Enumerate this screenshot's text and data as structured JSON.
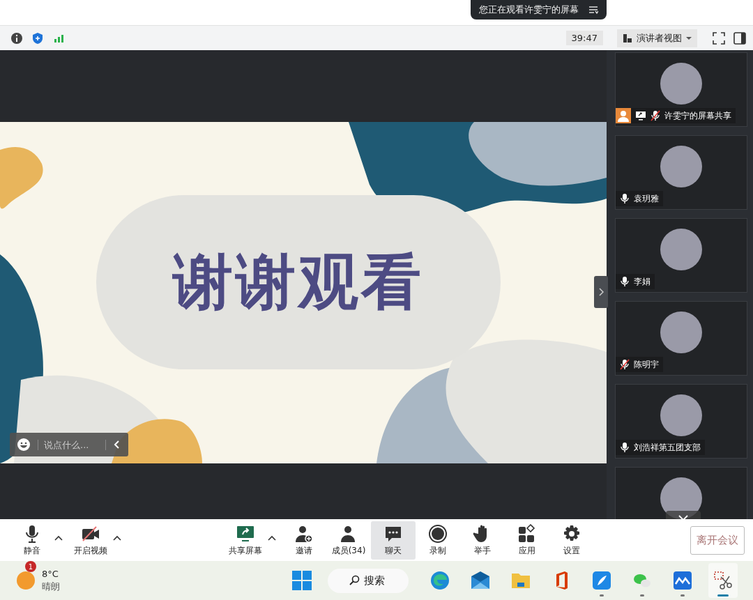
{
  "banner": {
    "text": "您正在观看许雯宁的屏幕"
  },
  "top_bar": {
    "timer": "39:47",
    "view_button": "演讲者视图"
  },
  "slide": {
    "title": "谢谢观看"
  },
  "chat_input": {
    "placeholder": "说点什么..."
  },
  "participants": [
    {
      "kind": "sharer",
      "name": "许雯宁的屏幕共享",
      "muted": true
    },
    {
      "kind": "member",
      "name": "袁玥雅",
      "muted": false
    },
    {
      "kind": "member",
      "name": "李娟",
      "muted": false
    },
    {
      "kind": "member",
      "name": "陈明宇",
      "muted": true
    },
    {
      "kind": "member",
      "name": "刘浩祥第五团支部",
      "muted": false
    },
    {
      "kind": "partial"
    }
  ],
  "toolbar": [
    {
      "kind": "mic",
      "label": "静音",
      "menu": true,
      "selected": false
    },
    {
      "kind": "video",
      "label": "开启视频",
      "menu": true,
      "selected": false
    },
    {
      "kind": "share",
      "label": "共享屏幕",
      "menu": true,
      "selected": false
    },
    {
      "kind": "invite",
      "label": "邀请",
      "menu": false,
      "selected": false
    },
    {
      "kind": "members",
      "label": "成员(34)",
      "menu": false,
      "selected": false
    },
    {
      "kind": "chat",
      "label": "聊天",
      "menu": false,
      "selected": true
    },
    {
      "kind": "record",
      "label": "录制",
      "menu": false,
      "selected": false
    },
    {
      "kind": "hand",
      "label": "举手",
      "menu": false,
      "selected": false
    },
    {
      "kind": "apps",
      "label": "应用",
      "menu": false,
      "selected": false
    },
    {
      "kind": "settings",
      "label": "设置",
      "menu": false,
      "selected": false
    }
  ],
  "leave_button": "离开会议",
  "taskbar": {
    "weather": {
      "badge": "1",
      "temperature": "8°C",
      "condition": "晴朗"
    },
    "search": "搜索",
    "apps": [
      {
        "kind": "edge",
        "running": false,
        "selected": false
      },
      {
        "kind": "mail",
        "running": false,
        "selected": false
      },
      {
        "kind": "folder",
        "running": false,
        "selected": false
      },
      {
        "kind": "office",
        "running": false,
        "selected": false
      },
      {
        "kind": "feather",
        "running": true,
        "selected": false
      },
      {
        "kind": "wechat",
        "running": true,
        "selected": false
      },
      {
        "kind": "meeting",
        "running": true,
        "selected": false
      },
      {
        "kind": "snip",
        "running": true,
        "selected": true
      }
    ]
  }
}
